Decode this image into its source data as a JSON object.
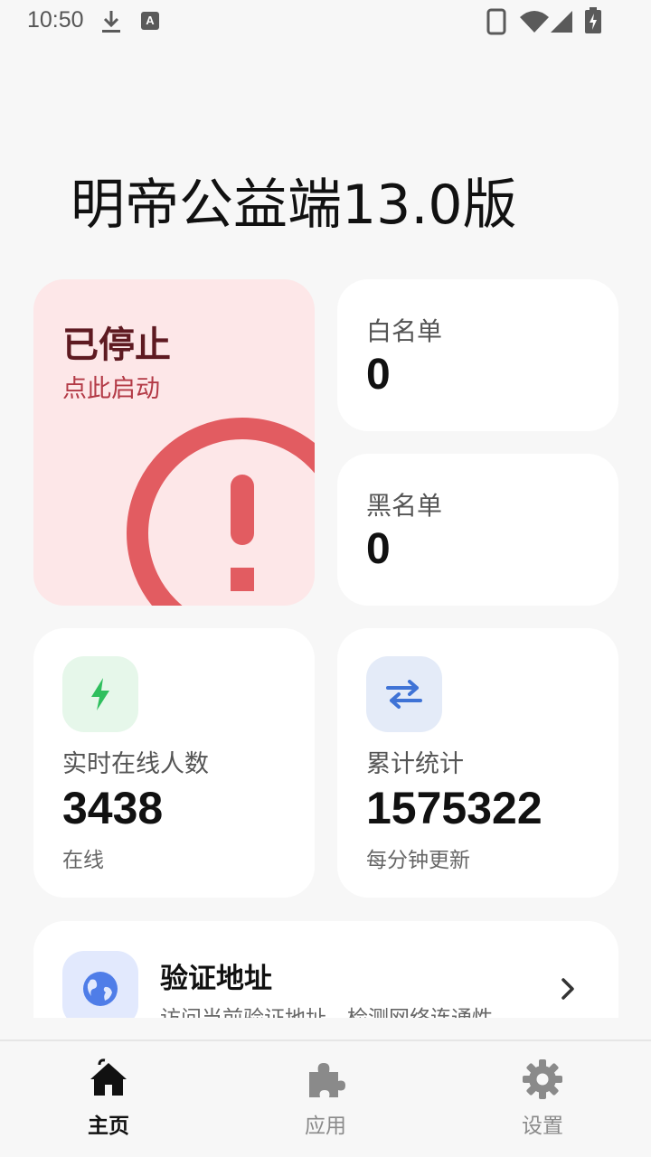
{
  "status_bar": {
    "time": "10:50",
    "icons": [
      "download-icon",
      "a-notification-icon",
      "phone-icon",
      "wifi-icon",
      "signal-icon",
      "battery-charging-icon"
    ],
    "a_badge": "A"
  },
  "page": {
    "title": "明帝公益端13.0版"
  },
  "status_card": {
    "title": "已停止",
    "subtitle": "点此启动",
    "icon": "alert-circle-icon",
    "color": "#e25c61"
  },
  "whitelist": {
    "label": "白名单",
    "count": "0"
  },
  "blacklist": {
    "label": "黑名单",
    "count": "0"
  },
  "online_stat": {
    "icon": "lightning-icon",
    "label": "实时在线人数",
    "value": "3438",
    "sub": "在线",
    "icon_color": "#2fbf5e",
    "icon_bg": "#e6f7ea"
  },
  "total_stat": {
    "icon": "swap-arrows-icon",
    "label": "累计统计",
    "value": "1575322",
    "sub": "每分钟更新",
    "icon_color": "#3f73d6",
    "icon_bg": "#e4ebf8"
  },
  "verify": {
    "icon": "globe-icon",
    "title": "验证地址",
    "description": "访问当前验证地址，检测网络连通性",
    "icon_color": "#4f7de8"
  },
  "bottom_nav": {
    "items": [
      {
        "label": "主页",
        "icon": "home-icon",
        "active": true
      },
      {
        "label": "应用",
        "icon": "puzzle-icon",
        "active": false
      },
      {
        "label": "设置",
        "icon": "gear-icon",
        "active": false
      }
    ]
  }
}
